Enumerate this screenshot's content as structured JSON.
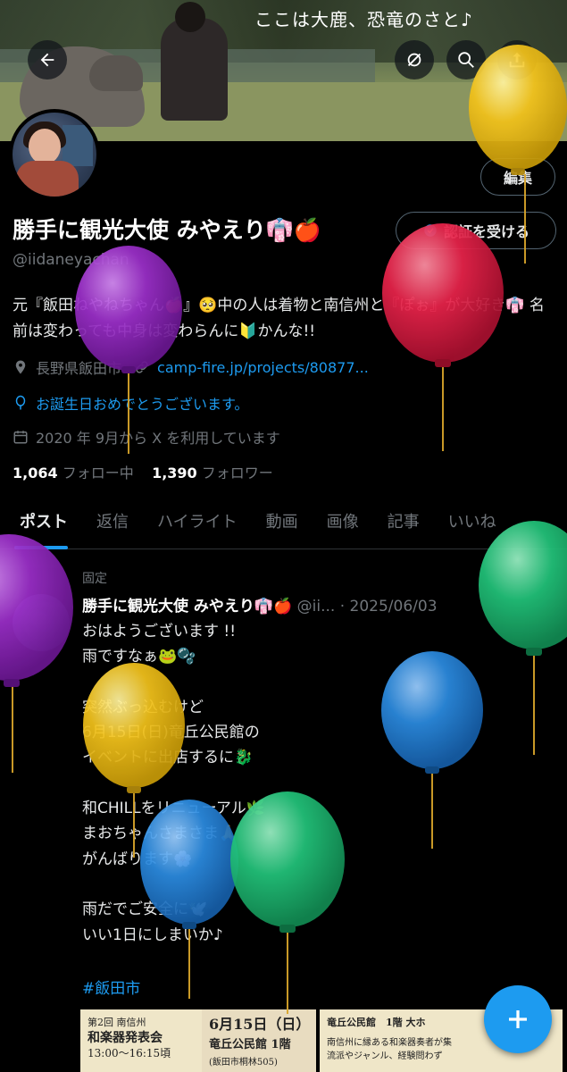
{
  "banner": {
    "caption": "ここは大鹿、恐竜のさと♪"
  },
  "profile": {
    "edit_label": "編集",
    "verify_label": "認証を受ける",
    "name": "勝手に観光大使 みやえり👘🍎",
    "handle": "@iidaneyachan",
    "bio": "元『飯田ねやねちゃん🍎』🥺中の人は着物と南信州と『ぽぉ』が大好き👘 名前は変わっても中身は変わらんに🔰かんな!!",
    "location": "長野県飯田市",
    "website": "camp-fire.jp/projects/80877...",
    "birthday": "お誕生日おめでとうございます。",
    "joined": "2020 年 9月から X を利用しています",
    "following_count": "1,064",
    "following_label": "フォロー中",
    "followers_count": "1,390",
    "followers_label": "フォロワー"
  },
  "tabs": [
    {
      "label": "ポスト"
    },
    {
      "label": "返信"
    },
    {
      "label": "ハイライト"
    },
    {
      "label": "動画"
    },
    {
      "label": "画像"
    },
    {
      "label": "記事"
    },
    {
      "label": "いいね"
    }
  ],
  "post": {
    "pinned_label": "固定",
    "author": "勝手に観光大使 みやえり👘🍎",
    "meta": "@ii... · 2025/06/03",
    "body": "おはようございます !!\n雨ですなぁ🐸🫧\n\n突然ぶっ込むけど\n6月15日(日)竜丘公民館の\nイベントに出店するに🐉\n\n和CHILLをリニューアル🌿\nまおちゃんさまさま🙏\nがんばります🌸\n\n雨だでご安全に🕊️\nいい1日にしまいか♪",
    "hashtag": "#飯田市"
  },
  "flyers": [
    {
      "line1": "第2回 南信州",
      "line2": "和楽器発表会",
      "line3": "13:00〜16:15頃"
    },
    {
      "line1": "6月15日（日）",
      "line2": "竜丘公民館 1階",
      "line3": "(飯田市桐林505)"
    },
    {
      "line1": "竜丘公民館　1階 大ホ",
      "line2": "南信州に縁ある和楽器奏者が集",
      "line3": "流派やジャンル、経験問わず"
    }
  ],
  "balloon_colors": {
    "yellow": "#f2c21b",
    "red": "#e8234a",
    "purple": "#9b2fc9",
    "green": "#22c37a",
    "blue": "#2b8be0"
  },
  "colors": {
    "accent": "#1d9bf0",
    "muted": "#71767b",
    "text": "#e7e9ea"
  }
}
